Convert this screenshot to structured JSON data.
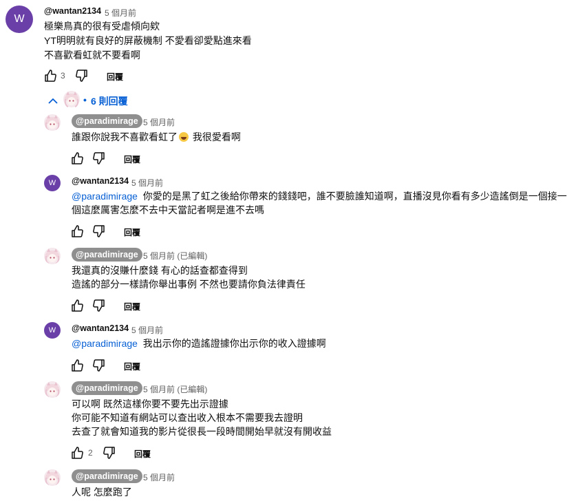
{
  "main_comment": {
    "avatar_letter": "W",
    "author": "@wantan2134",
    "time": "5 個月前",
    "lines": [
      "極樂鳥真的很有受虐傾向欸",
      "YT明明就有良好的屏蔽機制 不愛看卻愛點進來看",
      "不喜歡看虹就不要看啊"
    ],
    "likes": "3",
    "reply_label": "回覆"
  },
  "replies_toggle": {
    "label": "6 則回覆"
  },
  "replies": [
    {
      "author": "@paradimirage",
      "time": "5 個月前",
      "edited": "",
      "text_before": "誰跟你說我不喜歡看虹了",
      "text_after": " 我很愛看啊",
      "likes": "",
      "reply_label": "回覆"
    },
    {
      "avatar_letter": "W",
      "author": "@wantan2134",
      "time": "5 個月前",
      "mention": "@paradimirage",
      "lines": [
        "你愛的是黑了虹之後給你帶來的錢錢吧，誰不要臉誰知道啊，直播沒見你看有多少造謠倒是一個接一",
        "個這麼厲害怎麼不去中天當記者啊是進不去嗎"
      ],
      "reply_label": "回覆"
    },
    {
      "author": "@paradimirage",
      "time": "5 個月前 (已編輯)",
      "lines": [
        "我還真的沒賺什麼錢 有心的話查都查得到",
        "造謠的部分一樣請你舉出事例 不然也要請你負法律責任"
      ],
      "reply_label": "回覆"
    },
    {
      "avatar_letter": "W",
      "author": "@wantan2134",
      "time": "5 個月前",
      "mention": "@paradimirage",
      "text": "我出示你的造謠證據你出示你的收入證據啊",
      "reply_label": "回覆"
    },
    {
      "author": "@paradimirage",
      "time": "5 個月前 (已編輯)",
      "lines": [
        "可以啊 既然這樣你要不要先出示證據",
        "你可能不知道有網站可以查出收入根本不需要我去證明",
        "去查了就會知道我的影片從很長一段時間開始早就沒有開收益"
      ],
      "likes": "2",
      "reply_label": "回覆"
    },
    {
      "author": "@paradimirage",
      "time": "5 個月前",
      "text": "人呢 怎麼跑了"
    }
  ]
}
